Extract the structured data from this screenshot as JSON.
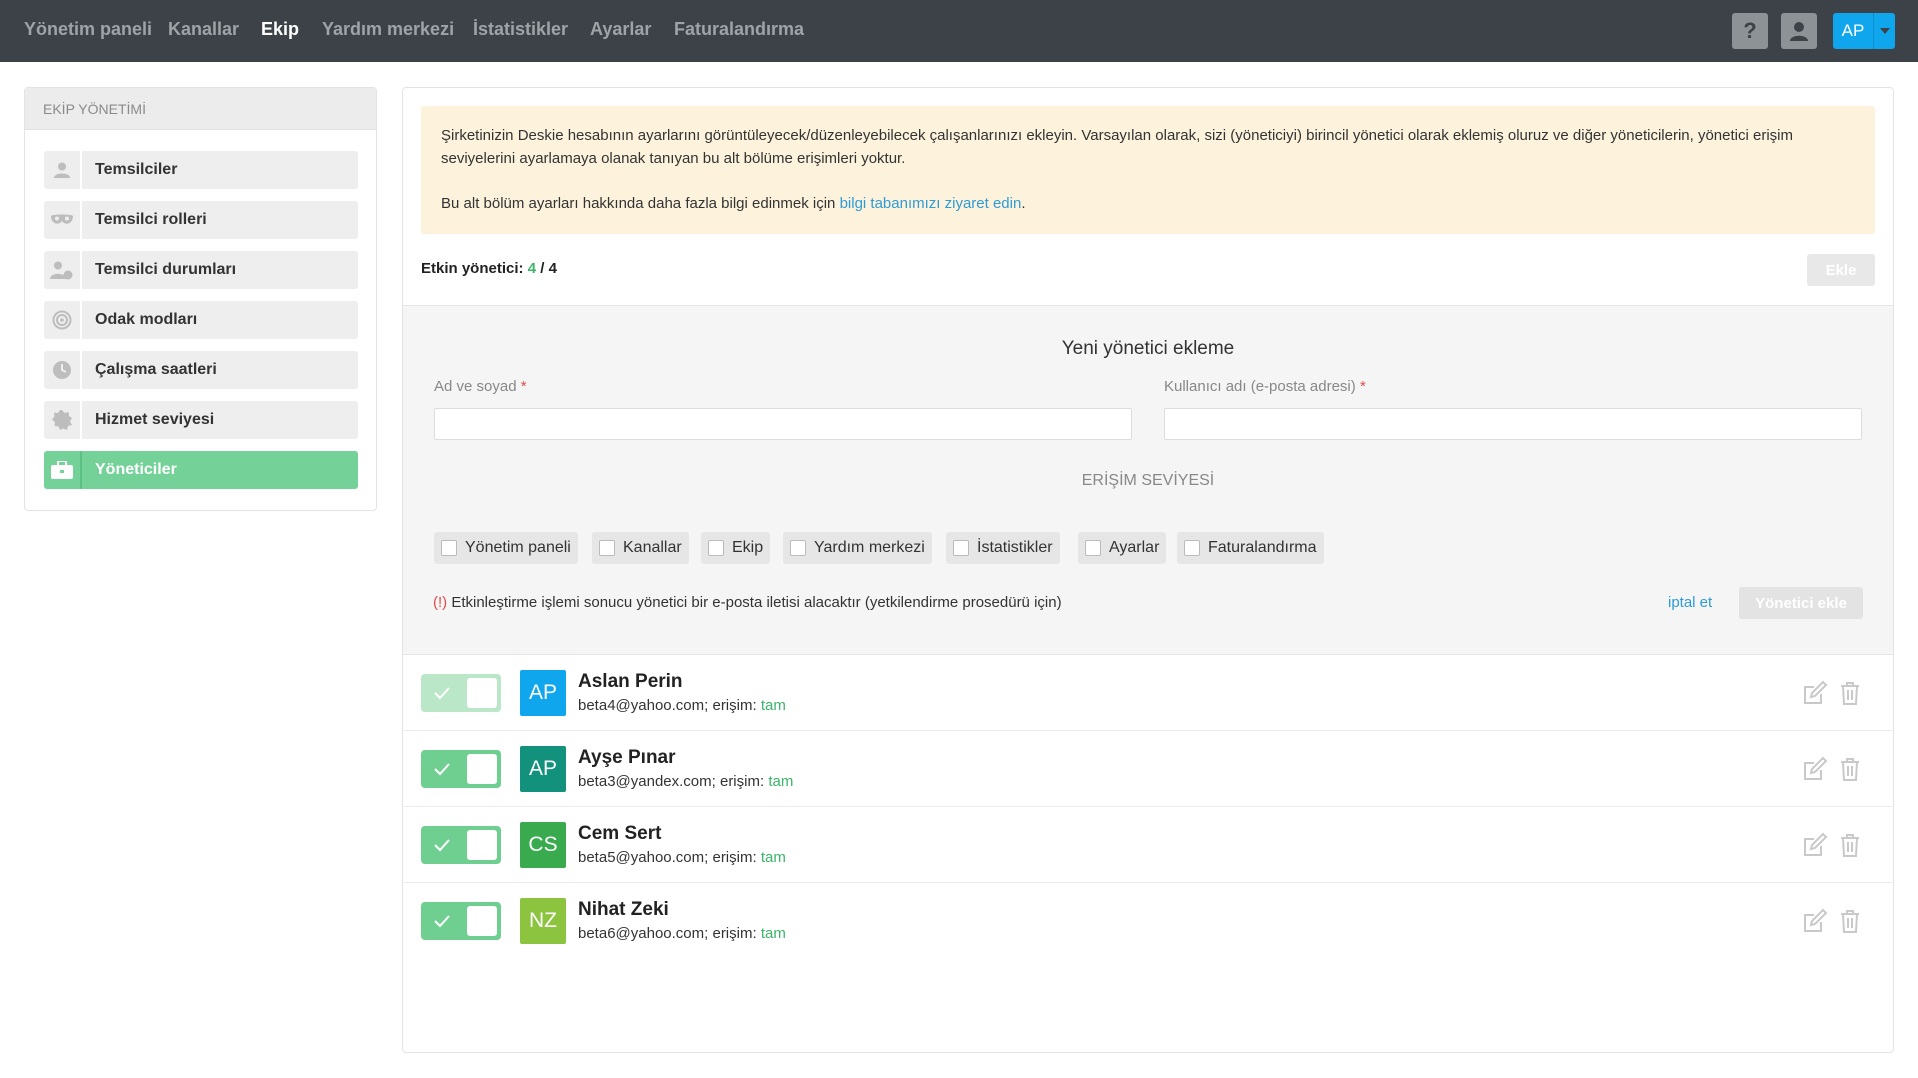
{
  "nav": {
    "items": [
      "Yönetim paneli",
      "Kanallar",
      "Ekip",
      "Yardım merkezi",
      "İstatistikler",
      "Ayarlar",
      "Faturalandırma"
    ],
    "active": "Ekip",
    "help_label": "?",
    "avatar_initials": "AP"
  },
  "sidebar": {
    "title": "EKİP YÖNETİMİ",
    "items": [
      {
        "label": "Temsilciler",
        "icon": "user-icon"
      },
      {
        "label": "Temsilci rolleri",
        "icon": "mask-icon"
      },
      {
        "label": "Temsilci durumları",
        "icon": "user-status-icon"
      },
      {
        "label": "Odak modları",
        "icon": "target-icon"
      },
      {
        "label": "Çalışma saatleri",
        "icon": "clock-icon"
      },
      {
        "label": "Hizmet seviyesi",
        "icon": "badge-icon"
      },
      {
        "label": "Yöneticiler",
        "icon": "briefcase-icon"
      }
    ],
    "active": "Yöneticiler"
  },
  "info": {
    "paragraph1": "Şirketinizin Deskie hesabının ayarlarını görüntüleyecek/düzenleyebilecek çalışanlarınızı ekleyin. Varsayılan olarak, sizi (yöneticiyi) birincil yönetici olarak eklemiş oluruz ve diğer yöneticilerin, yönetici erişim seviyelerini ayarlamaya olanak tanıyan bu alt bölüme erişimleri yoktur.",
    "paragraph2_prefix": "Bu alt bölüm ayarları hakkında daha fazla bilgi edinmek için ",
    "paragraph2_link": "bilgi tabanımızı ziyaret edin",
    "paragraph2_suffix": "."
  },
  "count": {
    "label": "Etkin yönetici:",
    "active": "4",
    "separator": " / ",
    "total": "4"
  },
  "add_button": "Ekle",
  "form": {
    "title": "Yeni yönetici ekleme",
    "name_label": "Ad ve soyad",
    "email_label": "Kullanıcı adı (e-posta adresi)",
    "required_mark": "*",
    "name_value": "",
    "email_value": "",
    "access_title": "ERİŞİM SEVİYESİ",
    "access_options": [
      "Yönetim paneli",
      "Kanallar",
      "Ekip",
      "Yardım merkezi",
      "İstatistikler",
      "Ayarlar",
      "Faturalandırma"
    ],
    "note_warn": "(!)",
    "note": " Etkinleştirme işlemi sonucu yönetici bir e-posta iletisi alacaktır (yetkilendirme prosedürü için)",
    "cancel": "iptal et",
    "submit": "Yönetici ekle"
  },
  "managers": [
    {
      "initials": "AP",
      "name": "Aslan Perin",
      "email": "beta4@yahoo.com; erişim: ",
      "access": "tam",
      "color": "#10a6ee",
      "enabled": true,
      "primary": true
    },
    {
      "initials": "AP",
      "name": "Ayşe Pınar",
      "email": "beta3@yandex.com; erişim: ",
      "access": "tam",
      "color": "#12917d",
      "enabled": true,
      "primary": false
    },
    {
      "initials": "CS",
      "name": "Cem Sert",
      "email": "beta5@yahoo.com; erişim: ",
      "access": "tam",
      "color": "#3aaa4f",
      "enabled": true,
      "primary": false
    },
    {
      "initials": "NZ",
      "name": "Nihat Zeki",
      "email": "beta6@yahoo.com; erişim: ",
      "access": "tam",
      "color": "#8cc43f",
      "enabled": true,
      "primary": false
    }
  ],
  "colors": {
    "nav_bg": "#3c4247",
    "accent_green": "#74d299",
    "link_blue": "#2f9bd6",
    "info_bg": "#fdf3dd"
  }
}
